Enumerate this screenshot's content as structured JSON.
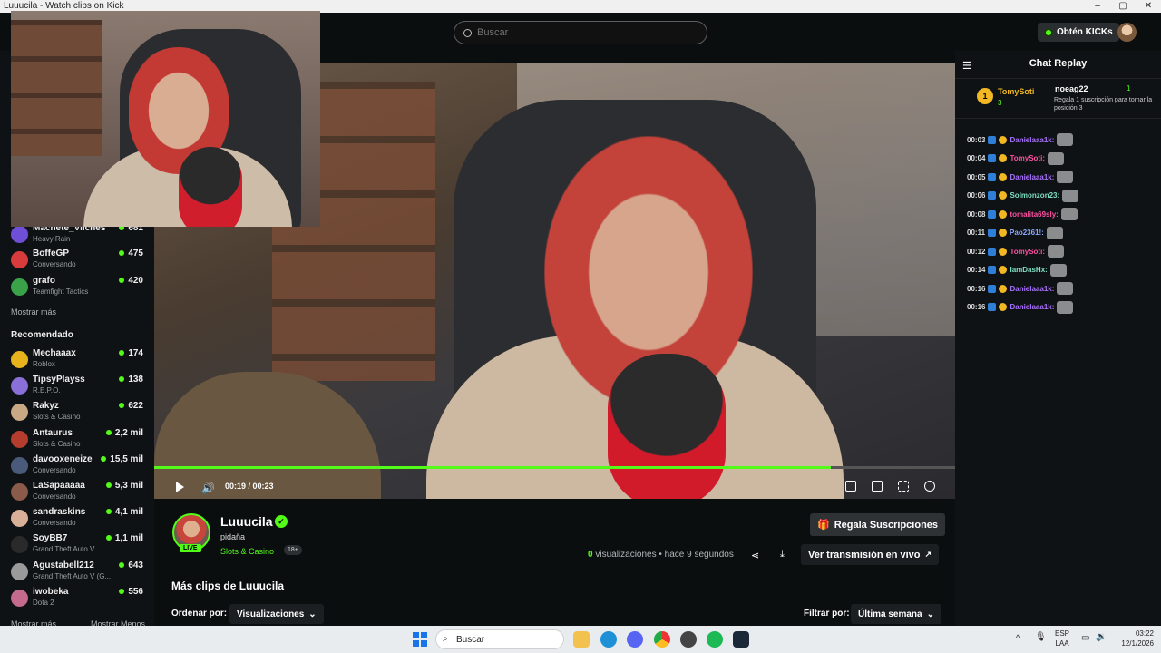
{
  "window": {
    "title": "Luuucila - Watch clips on Kick",
    "controls": [
      "–",
      "▢",
      "✕"
    ]
  },
  "header": {
    "search_placeholder": "Buscar",
    "kicks_label": "Obtén KICKs"
  },
  "sidebar": {
    "following": [
      {
        "name": "Machete_Vilches",
        "category": "Heavy Rain",
        "viewers": "681",
        "color": "#6f4fd8"
      },
      {
        "name": "BoffeGP",
        "category": "Conversando",
        "viewers": "475",
        "color": "#d73b3b"
      },
      {
        "name": "grafo",
        "category": "Teamfight Tactics",
        "viewers": "420",
        "color": "#3aa34a"
      }
    ],
    "show_more": "Mostrar más",
    "recommended_heading": "Recomendado",
    "recommended": [
      {
        "name": "Mechaaax",
        "category": "Roblox",
        "viewers": "174",
        "color": "#e7b31c"
      },
      {
        "name": "TipsyPlayss",
        "category": "R.E.P.O.",
        "viewers": "138",
        "color": "#8a6fd8"
      },
      {
        "name": "Rakyz",
        "category": "Slots & Casino",
        "viewers": "622",
        "color": "#c9a884"
      },
      {
        "name": "Antaurus",
        "category": "Slots & Casino",
        "viewers": "2,2 mil",
        "color": "#b53d2e"
      },
      {
        "name": "davooxeneize",
        "category": "Conversando",
        "viewers": "15,5 mil",
        "color": "#4a5a7a"
      },
      {
        "name": "LaSapaaaaa",
        "category": "Conversando",
        "viewers": "5,3 mil",
        "color": "#8a5a4a"
      },
      {
        "name": "sandraskins",
        "category": "Conversando",
        "viewers": "4,1 mil",
        "color": "#d8b09a"
      },
      {
        "name": "SoyBB7",
        "category": "Grand Theft Auto V ...",
        "viewers": "1,1 mil",
        "color": "#2a2a2a"
      },
      {
        "name": "Agustabell212",
        "category": "Grand Theft Auto V (G...",
        "viewers": "643",
        "color": "#9a9a9a"
      },
      {
        "name": "iwobeka",
        "category": "Dota 2",
        "viewers": "556",
        "color": "#c46a8a"
      }
    ],
    "show_more_bottom": "Mostrar más",
    "show_less": "Mostrar Menos"
  },
  "player": {
    "time_current": "00:19",
    "time_total": "00:23",
    "progress_fraction": 0.845
  },
  "clip": {
    "channel": "Luuucila",
    "live_badge": "LIVE",
    "title": "pidaña",
    "category": "Slots & Casino",
    "age_rating": "18+",
    "gift_label": "Regala Suscripciones",
    "views_count": "0",
    "views_label": "visualizaciones",
    "time_ago": "• hace 9 segundos",
    "watch_live_label": "Ver transmisión en vivo",
    "more_clips_heading": "Más clips de Luuucila",
    "order_label": "Ordenar por:",
    "order_value": "Visualizaciones",
    "filter_label": "Filtrar por:",
    "filter_value": "Última semana"
  },
  "chat": {
    "title": "Chat Replay",
    "top_gifter": {
      "rank": "1",
      "name": "TomySoti",
      "count": "3"
    },
    "recent_gifter": {
      "name": "noeag22",
      "count": "1",
      "message": "Regala 1 suscripción para tomar la posición 3"
    },
    "messages": [
      {
        "time": "00:03",
        "user": "Danielaaa1k:",
        "color": "#a970ff"
      },
      {
        "time": "00:04",
        "user": "TomySoti:",
        "color": "#ff4fa3"
      },
      {
        "time": "00:05",
        "user": "Danielaaa1k:",
        "color": "#a970ff"
      },
      {
        "time": "00:06",
        "user": "Solmonzon23:",
        "color": "#7ee0c2"
      },
      {
        "time": "00:08",
        "user": "tomalita69sly:",
        "color": "#ff4fa3"
      },
      {
        "time": "00:11",
        "user": "Pao2361!:",
        "color": "#8aa8ff"
      },
      {
        "time": "00:12",
        "user": "TomySoti:",
        "color": "#ff4fa3"
      },
      {
        "time": "00:14",
        "user": "IamDasHx:",
        "color": "#7ee0c2"
      },
      {
        "time": "00:16",
        "user": "Danielaaa1k:",
        "color": "#a970ff"
      },
      {
        "time": "00:16",
        "user": "Danielaaa1k:",
        "color": "#a970ff"
      }
    ]
  },
  "taskbar": {
    "search_label": "Buscar",
    "lang_top": "ESP",
    "lang_bottom": "LAA",
    "time": "03:22",
    "date": "12/1/2026"
  },
  "colors": {
    "brand": "#53fc18",
    "background": "#0b0e0f",
    "panel": "#0f1214"
  }
}
